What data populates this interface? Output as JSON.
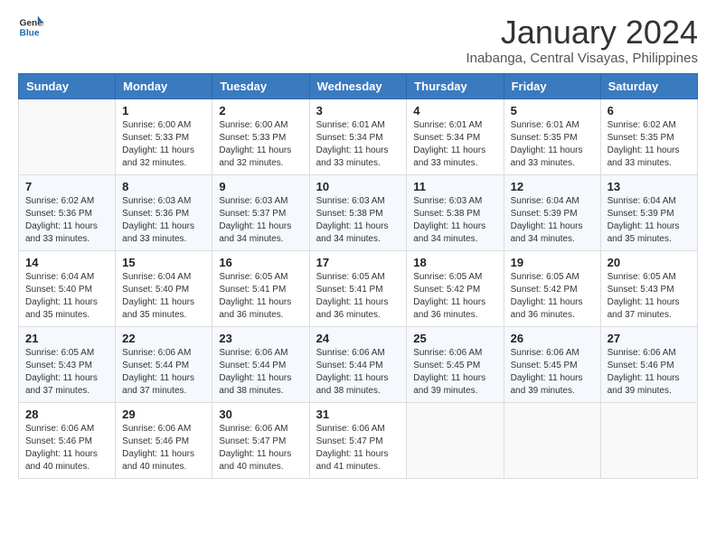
{
  "header": {
    "logo_line1": "General",
    "logo_line2": "Blue",
    "main_title": "January 2024",
    "subtitle": "Inabanga, Central Visayas, Philippines"
  },
  "calendar": {
    "weekdays": [
      "Sunday",
      "Monday",
      "Tuesday",
      "Wednesday",
      "Thursday",
      "Friday",
      "Saturday"
    ],
    "weeks": [
      [
        {
          "day": "",
          "info": ""
        },
        {
          "day": "1",
          "info": "Sunrise: 6:00 AM\nSunset: 5:33 PM\nDaylight: 11 hours\nand 32 minutes."
        },
        {
          "day": "2",
          "info": "Sunrise: 6:00 AM\nSunset: 5:33 PM\nDaylight: 11 hours\nand 32 minutes."
        },
        {
          "day": "3",
          "info": "Sunrise: 6:01 AM\nSunset: 5:34 PM\nDaylight: 11 hours\nand 33 minutes."
        },
        {
          "day": "4",
          "info": "Sunrise: 6:01 AM\nSunset: 5:34 PM\nDaylight: 11 hours\nand 33 minutes."
        },
        {
          "day": "5",
          "info": "Sunrise: 6:01 AM\nSunset: 5:35 PM\nDaylight: 11 hours\nand 33 minutes."
        },
        {
          "day": "6",
          "info": "Sunrise: 6:02 AM\nSunset: 5:35 PM\nDaylight: 11 hours\nand 33 minutes."
        }
      ],
      [
        {
          "day": "7",
          "info": "Sunrise: 6:02 AM\nSunset: 5:36 PM\nDaylight: 11 hours\nand 33 minutes."
        },
        {
          "day": "8",
          "info": "Sunrise: 6:03 AM\nSunset: 5:36 PM\nDaylight: 11 hours\nand 33 minutes."
        },
        {
          "day": "9",
          "info": "Sunrise: 6:03 AM\nSunset: 5:37 PM\nDaylight: 11 hours\nand 34 minutes."
        },
        {
          "day": "10",
          "info": "Sunrise: 6:03 AM\nSunset: 5:38 PM\nDaylight: 11 hours\nand 34 minutes."
        },
        {
          "day": "11",
          "info": "Sunrise: 6:03 AM\nSunset: 5:38 PM\nDaylight: 11 hours\nand 34 minutes."
        },
        {
          "day": "12",
          "info": "Sunrise: 6:04 AM\nSunset: 5:39 PM\nDaylight: 11 hours\nand 34 minutes."
        },
        {
          "day": "13",
          "info": "Sunrise: 6:04 AM\nSunset: 5:39 PM\nDaylight: 11 hours\nand 35 minutes."
        }
      ],
      [
        {
          "day": "14",
          "info": "Sunrise: 6:04 AM\nSunset: 5:40 PM\nDaylight: 11 hours\nand 35 minutes."
        },
        {
          "day": "15",
          "info": "Sunrise: 6:04 AM\nSunset: 5:40 PM\nDaylight: 11 hours\nand 35 minutes."
        },
        {
          "day": "16",
          "info": "Sunrise: 6:05 AM\nSunset: 5:41 PM\nDaylight: 11 hours\nand 36 minutes."
        },
        {
          "day": "17",
          "info": "Sunrise: 6:05 AM\nSunset: 5:41 PM\nDaylight: 11 hours\nand 36 minutes."
        },
        {
          "day": "18",
          "info": "Sunrise: 6:05 AM\nSunset: 5:42 PM\nDaylight: 11 hours\nand 36 minutes."
        },
        {
          "day": "19",
          "info": "Sunrise: 6:05 AM\nSunset: 5:42 PM\nDaylight: 11 hours\nand 36 minutes."
        },
        {
          "day": "20",
          "info": "Sunrise: 6:05 AM\nSunset: 5:43 PM\nDaylight: 11 hours\nand 37 minutes."
        }
      ],
      [
        {
          "day": "21",
          "info": "Sunrise: 6:05 AM\nSunset: 5:43 PM\nDaylight: 11 hours\nand 37 minutes."
        },
        {
          "day": "22",
          "info": "Sunrise: 6:06 AM\nSunset: 5:44 PM\nDaylight: 11 hours\nand 37 minutes."
        },
        {
          "day": "23",
          "info": "Sunrise: 6:06 AM\nSunset: 5:44 PM\nDaylight: 11 hours\nand 38 minutes."
        },
        {
          "day": "24",
          "info": "Sunrise: 6:06 AM\nSunset: 5:44 PM\nDaylight: 11 hours\nand 38 minutes."
        },
        {
          "day": "25",
          "info": "Sunrise: 6:06 AM\nSunset: 5:45 PM\nDaylight: 11 hours\nand 39 minutes."
        },
        {
          "day": "26",
          "info": "Sunrise: 6:06 AM\nSunset: 5:45 PM\nDaylight: 11 hours\nand 39 minutes."
        },
        {
          "day": "27",
          "info": "Sunrise: 6:06 AM\nSunset: 5:46 PM\nDaylight: 11 hours\nand 39 minutes."
        }
      ],
      [
        {
          "day": "28",
          "info": "Sunrise: 6:06 AM\nSunset: 5:46 PM\nDaylight: 11 hours\nand 40 minutes."
        },
        {
          "day": "29",
          "info": "Sunrise: 6:06 AM\nSunset: 5:46 PM\nDaylight: 11 hours\nand 40 minutes."
        },
        {
          "day": "30",
          "info": "Sunrise: 6:06 AM\nSunset: 5:47 PM\nDaylight: 11 hours\nand 40 minutes."
        },
        {
          "day": "31",
          "info": "Sunrise: 6:06 AM\nSunset: 5:47 PM\nDaylight: 11 hours\nand 41 minutes."
        },
        {
          "day": "",
          "info": ""
        },
        {
          "day": "",
          "info": ""
        },
        {
          "day": "",
          "info": ""
        }
      ]
    ]
  }
}
